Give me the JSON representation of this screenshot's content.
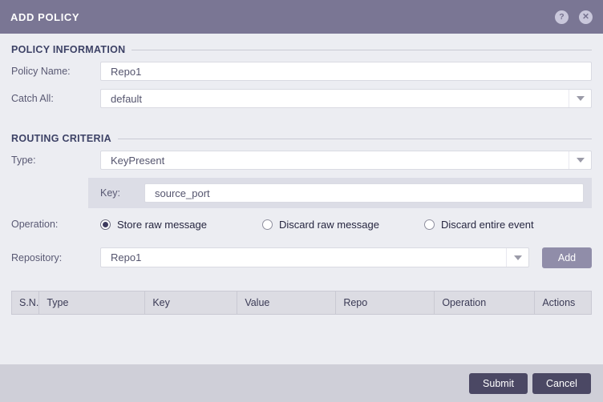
{
  "dialog": {
    "title": "ADD POLICY",
    "help_glyph": "?",
    "close_glyph": "✕"
  },
  "sections": {
    "policy_information": {
      "title": "POLICY INFORMATION"
    },
    "routing_criteria": {
      "title": "ROUTING CRITERIA"
    }
  },
  "fields": {
    "policy_name": {
      "label": "Policy Name:",
      "value": "Repo1"
    },
    "catch_all": {
      "label": "Catch All:",
      "value": "default"
    },
    "type": {
      "label": "Type:",
      "value": "KeyPresent"
    },
    "key": {
      "label": "Key:",
      "value": "source_port"
    },
    "operation": {
      "label": "Operation:",
      "options": [
        {
          "label": "Store raw message",
          "selected": true
        },
        {
          "label": "Discard raw message",
          "selected": false
        },
        {
          "label": "Discard entire event",
          "selected": false
        }
      ]
    },
    "repository": {
      "label": "Repository:",
      "value": "Repo1",
      "add_button": "Add"
    }
  },
  "table": {
    "columns": [
      "S.N.",
      "Type",
      "Key",
      "Value",
      "Repo",
      "Operation",
      "Actions"
    ],
    "rows": []
  },
  "footer": {
    "submit": "Submit",
    "cancel": "Cancel"
  },
  "colors": {
    "header_bg": "#7a7694",
    "body_bg": "#ecedf2",
    "section_title": "#3d4266",
    "subpanel_bg": "#dcdde6",
    "table_header_bg": "#dcdce3",
    "footer_bg": "#cfcfd8",
    "primary_button_bg": "#4b4864",
    "add_button_bg": "#908da9",
    "radio_selected": "#3e3b5e"
  }
}
